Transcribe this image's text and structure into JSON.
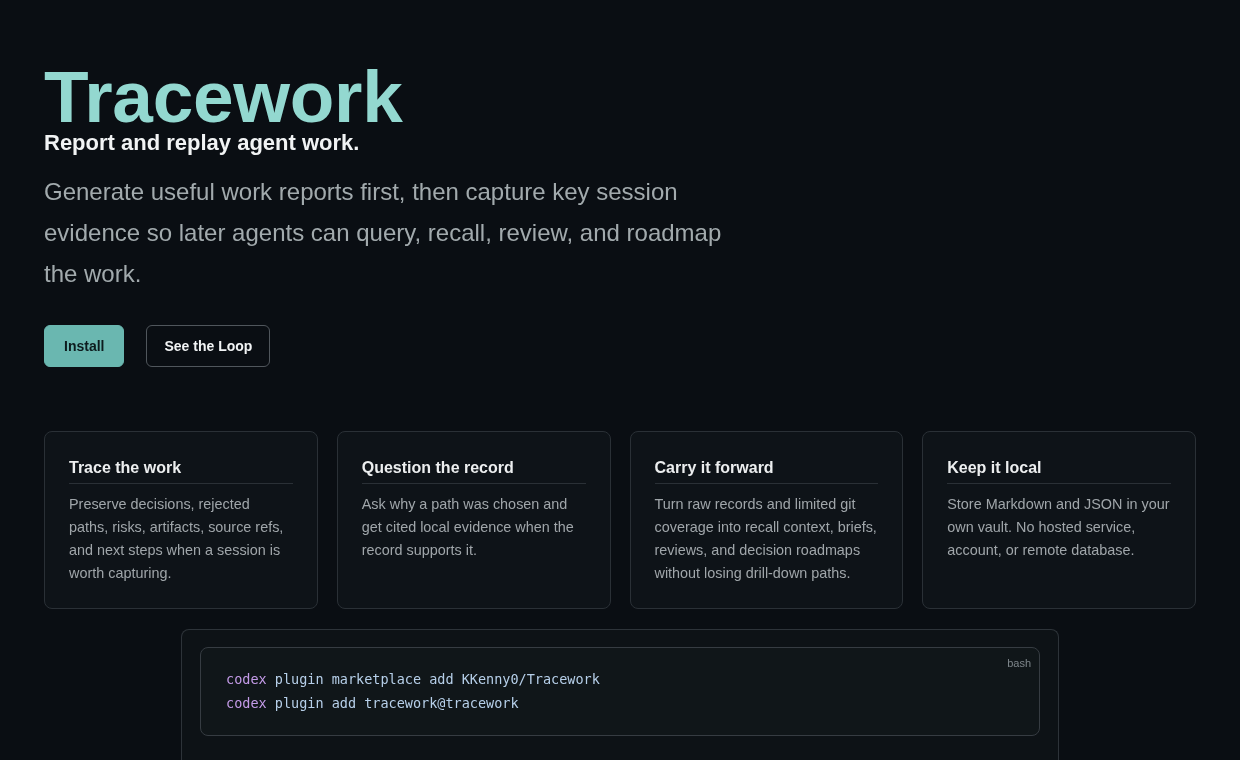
{
  "hero": {
    "title": "Tracework",
    "tagline": "Report and replay agent work.",
    "description": "Generate useful work reports first, then capture key session evidence so later agents can query, recall, review, and roadmap the work."
  },
  "actions": [
    {
      "label": "Install",
      "kind": "primary"
    },
    {
      "label": "See the Loop",
      "kind": "secondary"
    }
  ],
  "features": [
    {
      "title": "Trace the work",
      "text": "Preserve decisions, rejected paths, risks, artifacts, source refs, and next steps when a session is worth capturing."
    },
    {
      "title": "Question the record",
      "text": "Ask why a path was chosen and get cited local evidence when the record supports it."
    },
    {
      "title": "Carry it forward",
      "text": "Turn raw records and limited git coverage into recall context, briefs, reviews, and decision roadmaps without losing drill-down paths."
    },
    {
      "title": "Keep it local",
      "text": "Store Markdown and JSON in your own vault. No hosted service, account, or remote database."
    }
  ],
  "install": {
    "language": "bash",
    "lines": [
      {
        "tokens": [
          {
            "kind": "command",
            "text": "codex"
          },
          {
            "kind": "args",
            "text": "plugin marketplace add KKenny0/Tracework"
          }
        ]
      },
      {
        "tokens": [
          {
            "kind": "command",
            "text": "codex"
          },
          {
            "kind": "args",
            "text": "plugin add tracework@tracework"
          }
        ]
      }
    ]
  }
}
